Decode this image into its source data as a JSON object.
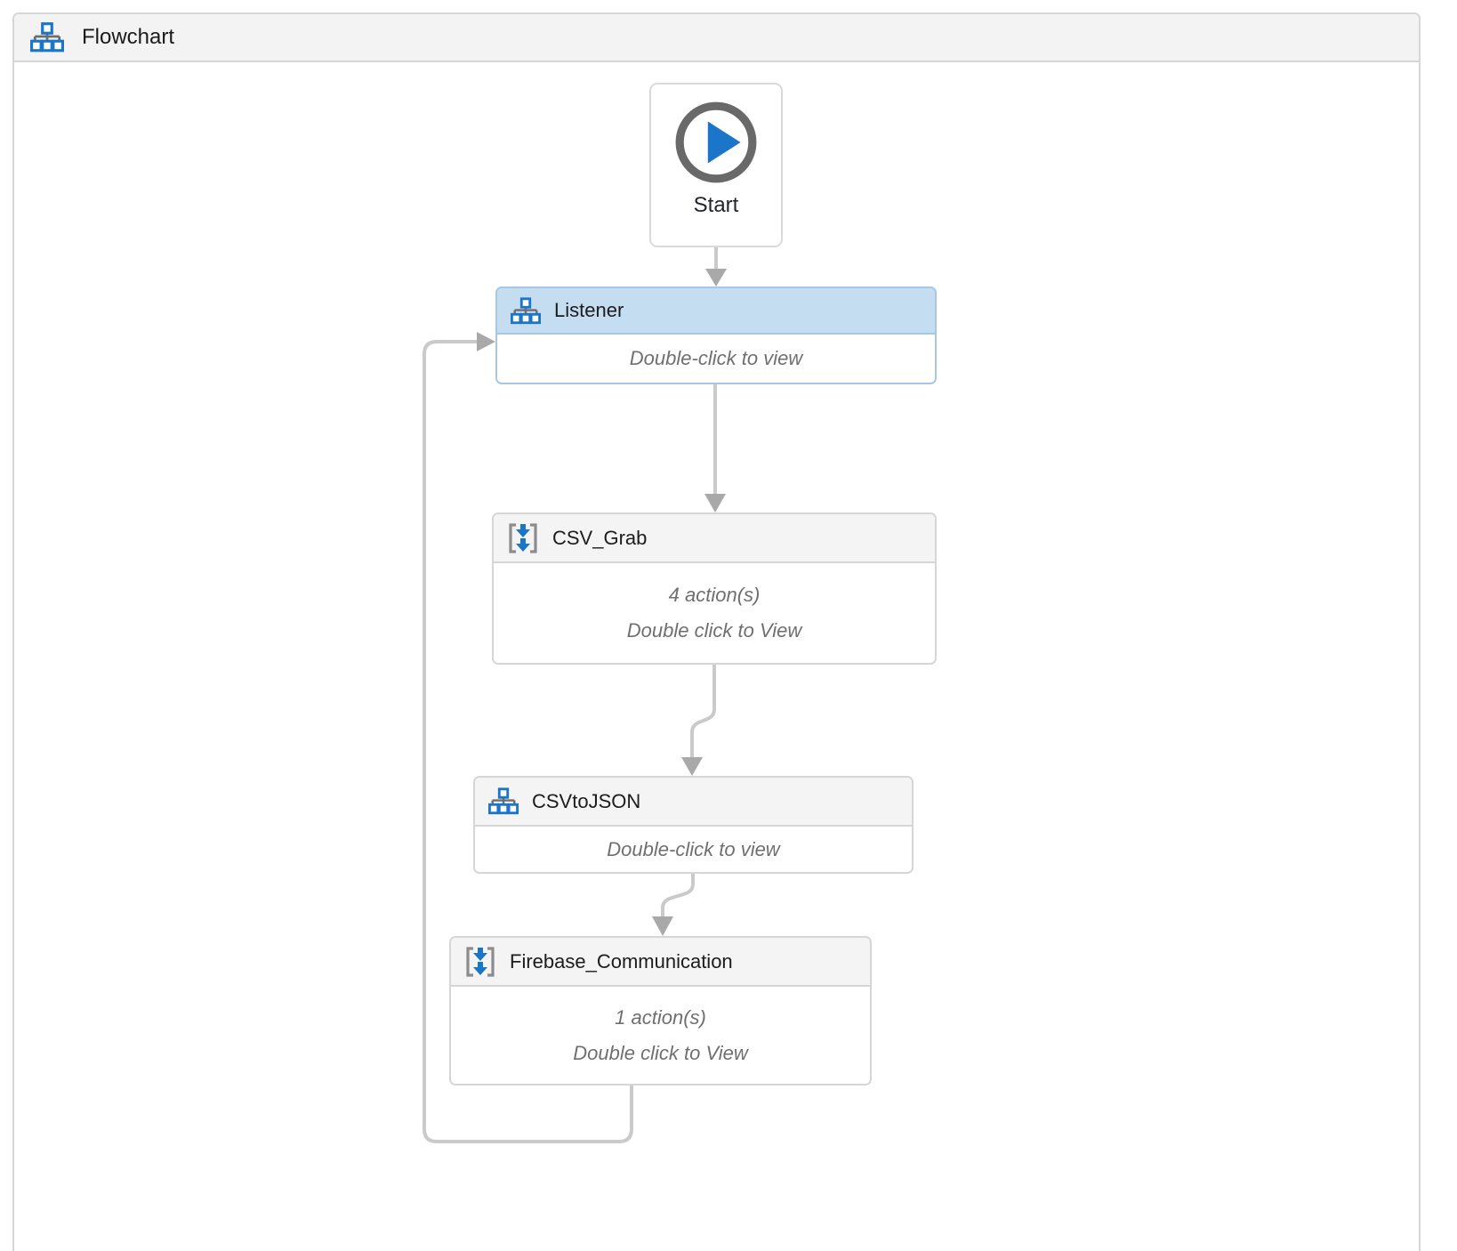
{
  "panel": {
    "title": "Flowchart"
  },
  "nodes": {
    "start": {
      "label": "Start"
    },
    "listener": {
      "title": "Listener",
      "hint": "Double-click to view"
    },
    "csv_grab": {
      "title": "CSV_Grab",
      "actions": "4 action(s)",
      "hint": "Double click to View"
    },
    "csvtojson": {
      "title": "CSVtoJSON",
      "hint": "Double-click to view"
    },
    "firebase": {
      "title": "Firebase_Communication",
      "actions": "1 action(s)",
      "hint": "Double click to View"
    }
  },
  "colors": {
    "accent_blue": "#1b75c8",
    "icon_gray": "#6d6d6d",
    "selected_header_bg": "#c5ddf1",
    "selected_border": "#a5c8e4",
    "node_border": "#d6d6d6",
    "node_header_bg": "#f4f4f4",
    "panel_header_bg": "#f3f3f3",
    "title_text": "#1c1c1c",
    "hint_text": "#6f6f6f",
    "connector_line": "#cacaca",
    "connector_arrow": "#a9a9a9",
    "play_ring": "#696969"
  }
}
